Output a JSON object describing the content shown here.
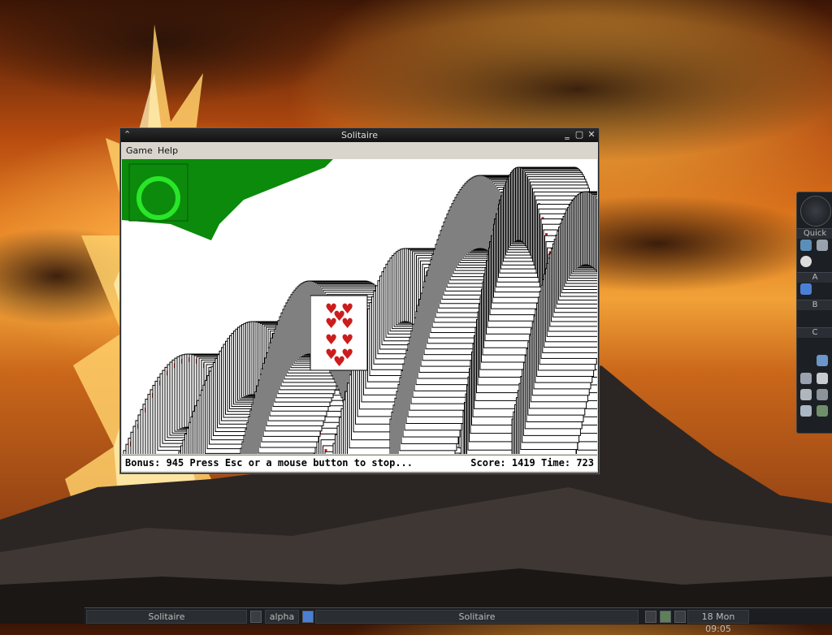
{
  "window": {
    "title": "Solitaire",
    "menu": [
      "Game",
      "Help"
    ],
    "status_left": "Bonus: 945  Press Esc or a mouse button to stop...",
    "status_right": "Score: 1419 Time: 723",
    "felt_color": "#0b8a0b",
    "card_red": "#cc1c1c"
  },
  "dock": {
    "sections": [
      "Quick",
      "A",
      "B",
      "C"
    ]
  },
  "taskbar": {
    "items": [
      "Solitaire",
      "alpha",
      "Solitaire"
    ],
    "clock": "18 Mon 09:05"
  }
}
